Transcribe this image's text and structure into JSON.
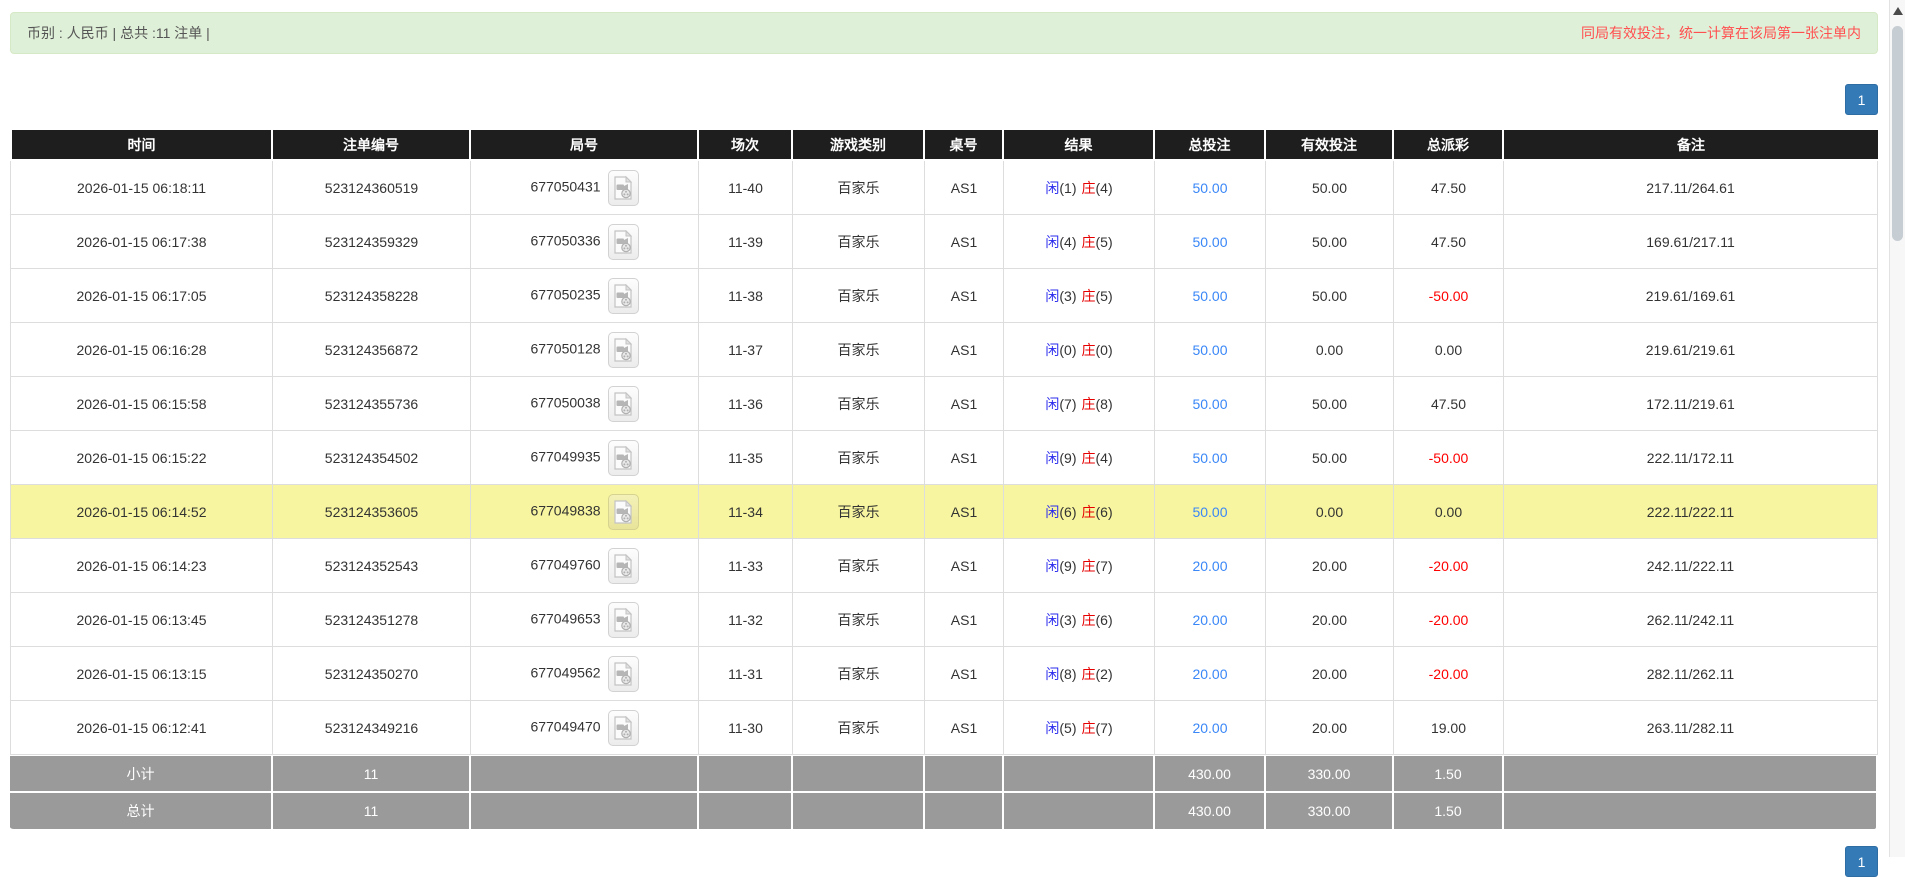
{
  "header_bar": {
    "left_text": "币别 : 人民币 | 总共 :11 注单 |",
    "right_notice": "同局有效投注，统一计算在该局第一张注单内"
  },
  "pagination": {
    "page": "1"
  },
  "table": {
    "columns": [
      "时间",
      "注单编号",
      "局号",
      "场次",
      "游戏类别",
      "桌号",
      "结果",
      "总投注",
      "有效投注",
      "总派彩",
      "备注"
    ],
    "labels": {
      "player": "闲",
      "banker": "庄"
    },
    "rows": [
      {
        "time": "2026-01-15 06:18:11",
        "bet_id": "523124360519",
        "round_id": "677050431",
        "session": "11-40",
        "game_type": "百家乐",
        "table_no": "AS1",
        "player_score": "(1)",
        "banker_score": "(4)",
        "total_bet": "50.00",
        "valid_bet": "50.00",
        "payout": "47.50",
        "remark": "217.11/264.61",
        "highlight": false
      },
      {
        "time": "2026-01-15 06:17:38",
        "bet_id": "523124359329",
        "round_id": "677050336",
        "session": "11-39",
        "game_type": "百家乐",
        "table_no": "AS1",
        "player_score": "(4)",
        "banker_score": "(5)",
        "total_bet": "50.00",
        "valid_bet": "50.00",
        "payout": "47.50",
        "remark": "169.61/217.11",
        "highlight": false
      },
      {
        "time": "2026-01-15 06:17:05",
        "bet_id": "523124358228",
        "round_id": "677050235",
        "session": "11-38",
        "game_type": "百家乐",
        "table_no": "AS1",
        "player_score": "(3)",
        "banker_score": "(5)",
        "total_bet": "50.00",
        "valid_bet": "50.00",
        "payout": "-50.00",
        "remark": "219.61/169.61",
        "highlight": false
      },
      {
        "time": "2026-01-15 06:16:28",
        "bet_id": "523124356872",
        "round_id": "677050128",
        "session": "11-37",
        "game_type": "百家乐",
        "table_no": "AS1",
        "player_score": "(0)",
        "banker_score": "(0)",
        "total_bet": "50.00",
        "valid_bet": "0.00",
        "payout": "0.00",
        "remark": "219.61/219.61",
        "highlight": false
      },
      {
        "time": "2026-01-15 06:15:58",
        "bet_id": "523124355736",
        "round_id": "677050038",
        "session": "11-36",
        "game_type": "百家乐",
        "table_no": "AS1",
        "player_score": "(7)",
        "banker_score": "(8)",
        "total_bet": "50.00",
        "valid_bet": "50.00",
        "payout": "47.50",
        "remark": "172.11/219.61",
        "highlight": false
      },
      {
        "time": "2026-01-15 06:15:22",
        "bet_id": "523124354502",
        "round_id": "677049935",
        "session": "11-35",
        "game_type": "百家乐",
        "table_no": "AS1",
        "player_score": "(9)",
        "banker_score": "(4)",
        "total_bet": "50.00",
        "valid_bet": "50.00",
        "payout": "-50.00",
        "remark": "222.11/172.11",
        "highlight": false
      },
      {
        "time": "2026-01-15 06:14:52",
        "bet_id": "523124353605",
        "round_id": "677049838",
        "session": "11-34",
        "game_type": "百家乐",
        "table_no": "AS1",
        "player_score": "(6)",
        "banker_score": "(6)",
        "total_bet": "50.00",
        "valid_bet": "0.00",
        "payout": "0.00",
        "remark": "222.11/222.11",
        "highlight": true
      },
      {
        "time": "2026-01-15 06:14:23",
        "bet_id": "523124352543",
        "round_id": "677049760",
        "session": "11-33",
        "game_type": "百家乐",
        "table_no": "AS1",
        "player_score": "(9)",
        "banker_score": "(7)",
        "total_bet": "20.00",
        "valid_bet": "20.00",
        "payout": "-20.00",
        "remark": "242.11/222.11",
        "highlight": false
      },
      {
        "time": "2026-01-15 06:13:45",
        "bet_id": "523124351278",
        "round_id": "677049653",
        "session": "11-32",
        "game_type": "百家乐",
        "table_no": "AS1",
        "player_score": "(3)",
        "banker_score": "(6)",
        "total_bet": "20.00",
        "valid_bet": "20.00",
        "payout": "-20.00",
        "remark": "262.11/242.11",
        "highlight": false
      },
      {
        "time": "2026-01-15 06:13:15",
        "bet_id": "523124350270",
        "round_id": "677049562",
        "session": "11-31",
        "game_type": "百家乐",
        "table_no": "AS1",
        "player_score": "(8)",
        "banker_score": "(2)",
        "total_bet": "20.00",
        "valid_bet": "20.00",
        "payout": "-20.00",
        "remark": "282.11/262.11",
        "highlight": false
      },
      {
        "time": "2026-01-15 06:12:41",
        "bet_id": "523124349216",
        "round_id": "677049470",
        "session": "11-30",
        "game_type": "百家乐",
        "table_no": "AS1",
        "player_score": "(5)",
        "banker_score": "(7)",
        "total_bet": "20.00",
        "valid_bet": "20.00",
        "payout": "19.00",
        "remark": "263.11/282.11",
        "highlight": false
      }
    ],
    "subtotal": {
      "label": "小计",
      "count": "11",
      "total_bet": "430.00",
      "valid_bet": "330.00",
      "payout": "1.50"
    },
    "total": {
      "label": "总计",
      "count": "11",
      "total_bet": "430.00",
      "valid_bet": "330.00",
      "payout": "1.50"
    }
  },
  "icons": {
    "round_video": "video-file-icon",
    "scroll_up": "scroll-up-arrow-icon"
  },
  "colors": {
    "notice_red": "#ff5050",
    "link_blue": "#3a87f7",
    "player_blue": "#2b2bee",
    "banker_red": "#e60000",
    "negative_red": "#ff0000",
    "highlight_yellow": "#f7f59f",
    "pagination_blue": "#337ab7",
    "header_black": "#1e1e1e",
    "footer_gray": "#9a9a9a",
    "alert_green_bg": "#dff0d8",
    "alert_green_border": "#d6e9c6"
  }
}
